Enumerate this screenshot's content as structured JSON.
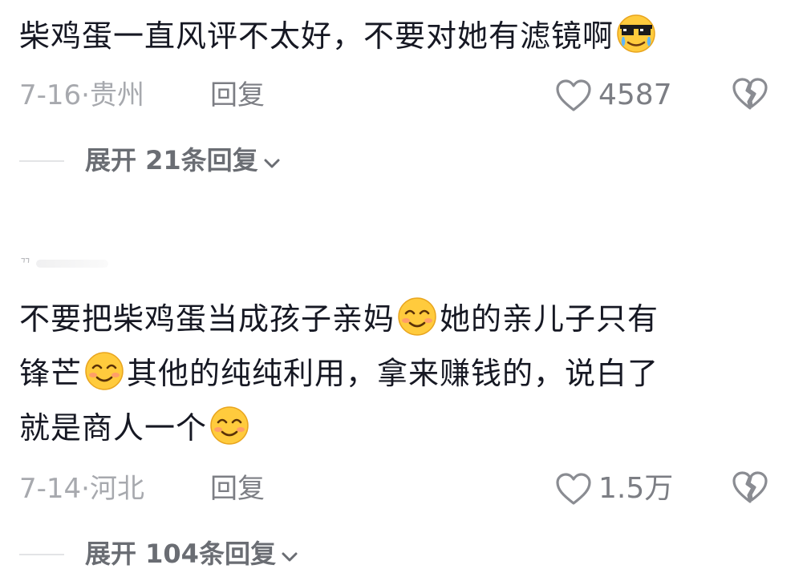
{
  "comments": [
    {
      "text_parts": [
        "柴鸡蛋一直风评不太好，不要对她有滤镜啊"
      ],
      "emoji": "sunglasses-tears-emoji",
      "date": "7-16",
      "location": "贵州",
      "reply_label": "回复",
      "likes": "4587",
      "expand_label": "展开 21条回复"
    },
    {
      "username_fragment": "ᄁ",
      "line1_a": "不要把柴鸡蛋当成孩子亲妈",
      "line1_b": "她的亲儿子只有",
      "line2_a": "锋芒",
      "line2_b": "其他的纯纯利用，拿来赚钱的，说白了",
      "line3_a": "就是商人一个",
      "emoji": "smiling-blush-emoji",
      "date": "7-14",
      "location": "河北",
      "reply_label": "回复",
      "likes": "1.5万",
      "expand_label": "展开 104条回复"
    }
  ],
  "date_separator": "·",
  "colors": {
    "text_primary": "#161823",
    "text_meta": "#a7a9ae",
    "text_action": "#7c7e84",
    "expand_text": "#6a6d73",
    "divider": "#e3e4e6"
  }
}
